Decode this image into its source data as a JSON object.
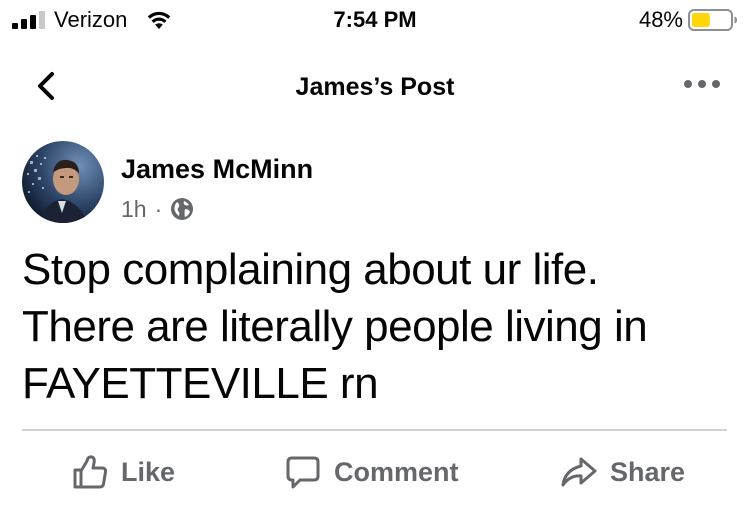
{
  "status_bar": {
    "carrier": "Verizon",
    "time": "7:54 PM",
    "battery_percent": "48%",
    "battery_level": 0.48,
    "battery_color": "#ffd60a",
    "signal_icon": "cellular-signal-icon",
    "wifi_icon": "wifi-icon",
    "battery_icon": "battery-icon"
  },
  "nav": {
    "title": "James’s Post",
    "back_icon": "chevron-left-icon",
    "more_icon": "more-horizontal-icon"
  },
  "post": {
    "author": "James McMinn",
    "time": "1h",
    "separator": "·",
    "audience_icon": "globe-icon",
    "text_lines": [
      "Stop complaining about ur life.",
      "There are literally people living in",
      "FAYETTEVILLE rn"
    ]
  },
  "actions": {
    "like": {
      "label": "Like",
      "icon": "thumbs-up-icon"
    },
    "comment": {
      "label": "Comment",
      "icon": "comment-icon"
    },
    "share": {
      "label": "Share",
      "icon": "share-icon"
    }
  },
  "colors": {
    "text_primary": "#050505",
    "text_secondary": "#65676b",
    "divider": "#ced0d4"
  }
}
